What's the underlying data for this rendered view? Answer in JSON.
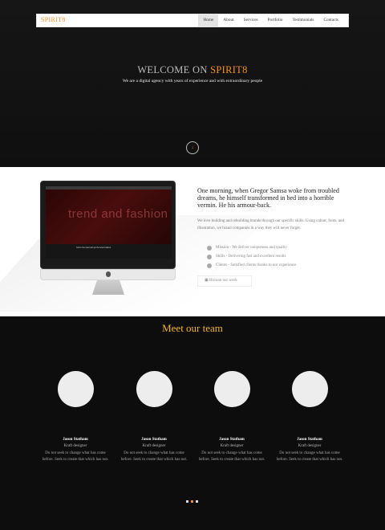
{
  "nav": {
    "logo": "SPIRIT8",
    "items": [
      "Home",
      "About",
      "Services",
      "Portfolio",
      "Testimonials",
      "Contacts"
    ],
    "active": "Home"
  },
  "hero": {
    "title_prefix": "WELCOME ON ",
    "title_brand": "SPIRIT8",
    "subtitle": "We are a digital agency with years of experience and with extraordinary people",
    "scroll_button": "↓"
  },
  "about": {
    "screen_text": "trend and fashion",
    "screen_caption": "follow the trend and get the latest fashion",
    "heading": "One morning, when Gregor Samsa woke from troubled dreams, he himself transformed in bed into a horrible vermin. He his armour-back.",
    "body": "We love building and rebuilding brands through our specific skills. Using colour, fonts, and illustration, we brand companies in a way they will never forget.",
    "features": [
      "Mission - We deliver uniqueness and quality",
      "Skills - Delivering fast and excellent results",
      "Clients - Satisfied clients thanks to our experience"
    ],
    "button": "Browse our work"
  },
  "team": {
    "title": "Meet our team",
    "members": [
      {
        "name": "Jason Statham",
        "role": "Kraft designer",
        "text": "Do not seek to change what has come before. Seek to create that which has not."
      },
      {
        "name": "Jason Statham",
        "role": "Kraft designer",
        "text": "Do not seek to change what has come before. Seek to create that which has not."
      },
      {
        "name": "Jason Statham",
        "role": "Kraft designer",
        "text": "Do not seek to change what has come before. Seek to create that which has not."
      },
      {
        "name": "Jason Statham",
        "role": "Kraft designer",
        "text": "Do not seek to change what has come before. Seek to create that which has not."
      }
    ],
    "pager_pages": 3,
    "pager_active": 1
  },
  "colors": {
    "accent": "#f2902a",
    "team_title": "#f2b52a"
  }
}
